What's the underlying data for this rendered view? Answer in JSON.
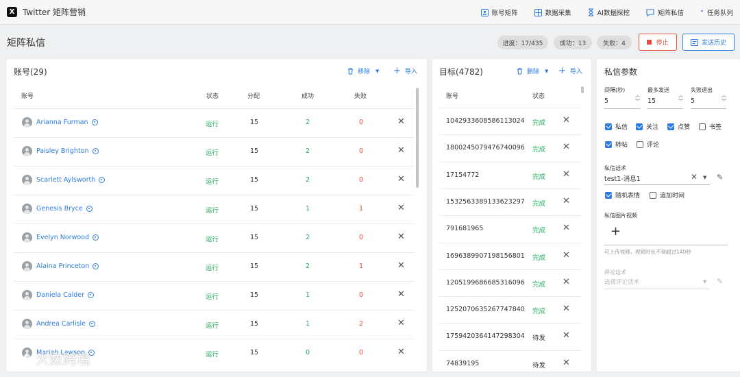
{
  "app": {
    "logo": "X",
    "title": "Twitter 矩阵营销"
  },
  "nav": [
    {
      "label": "账号矩阵",
      "icon": "account-matrix-icon"
    },
    {
      "label": "数据采集",
      "icon": "grid-icon"
    },
    {
      "label": "AI数据探挖",
      "icon": "hourglass-icon"
    },
    {
      "label": "矩阵私信",
      "icon": "chat-icon"
    },
    {
      "label": "任务队列",
      "icon": "dot-icon"
    }
  ],
  "page": {
    "title": "矩阵私信"
  },
  "stats": {
    "progress": "进度：17/435",
    "success": "成功：13",
    "fail": "失败：4"
  },
  "buttons": {
    "stop": "停止",
    "history": "发送历史"
  },
  "accounts": {
    "title": "账号(29)",
    "remove": "移除",
    "import": "导入",
    "columns": [
      "账号",
      "状态",
      "分配",
      "成功",
      "失败"
    ],
    "rows": [
      {
        "name": "Arianna Furman",
        "status": "运行",
        "alloc": "15",
        "success": "2",
        "fail": "0"
      },
      {
        "name": "Paisley Brighton",
        "status": "运行",
        "alloc": "15",
        "success": "2",
        "fail": "0"
      },
      {
        "name": "Scarlett Aylsworth",
        "status": "运行",
        "alloc": "15",
        "success": "2",
        "fail": "0"
      },
      {
        "name": "Genesis Bryce",
        "status": "运行",
        "alloc": "15",
        "success": "1",
        "fail": "1"
      },
      {
        "name": "Evelyn Norwood",
        "status": "运行",
        "alloc": "15",
        "success": "2",
        "fail": "0"
      },
      {
        "name": "Alaina Princeton",
        "status": "运行",
        "alloc": "15",
        "success": "2",
        "fail": "1"
      },
      {
        "name": "Daniela Calder",
        "status": "运行",
        "alloc": "15",
        "success": "1",
        "fail": "0"
      },
      {
        "name": "Andrea Carlisle",
        "status": "运行",
        "alloc": "15",
        "success": "1",
        "fail": "2"
      },
      {
        "name": "Mariah Lawson",
        "status": "运行",
        "alloc": "15",
        "success": "0",
        "fail": "0"
      }
    ]
  },
  "targets": {
    "title": "目标(4782)",
    "delete": "删除",
    "import": "导入",
    "columns": [
      "账号",
      "状态"
    ],
    "rows": [
      {
        "id": "1042933608586113024",
        "status": "完成"
      },
      {
        "id": "1800245079476740096",
        "status": "完成"
      },
      {
        "id": "17154772",
        "status": "完成"
      },
      {
        "id": "1532563389133623297",
        "status": "完成"
      },
      {
        "id": "791681965",
        "status": "完成"
      },
      {
        "id": "1696389907198156801",
        "status": "完成"
      },
      {
        "id": "1205199686685316096",
        "status": "完成"
      },
      {
        "id": "1252070635267747840",
        "status": "完成"
      },
      {
        "id": "1759420364147298304",
        "status": "待发"
      },
      {
        "id": "74839195",
        "status": "待发"
      }
    ]
  },
  "params": {
    "title": "私信参数",
    "interval_label": "间隔(秒)",
    "interval_value": "5",
    "max_label": "最多发送",
    "max_value": "15",
    "fail_label": "失败退出",
    "fail_value": "5",
    "checks": [
      {
        "label": "私信",
        "checked": true
      },
      {
        "label": "关注",
        "checked": true
      },
      {
        "label": "点赞",
        "checked": true
      },
      {
        "label": "书签",
        "checked": false
      },
      {
        "label": "转帖",
        "checked": true
      },
      {
        "label": "评论",
        "checked": false
      }
    ],
    "script_label": "私信话术",
    "script_value": "test1-消息1",
    "random_emoji": "随机表情",
    "add_time": "追加时间",
    "media_label": "私信图片视频",
    "media_hint": "可上传视频，视频时长不得超过140秒",
    "comment_label": "评论话术",
    "comment_placeholder": "选择评论话术"
  },
  "watermark": "大数跨境"
}
